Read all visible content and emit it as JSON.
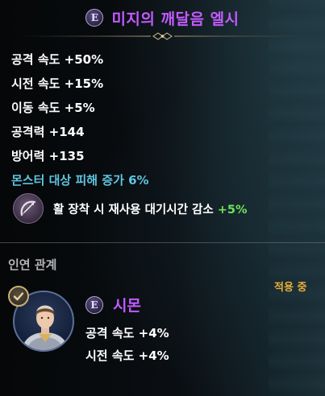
{
  "item": {
    "grade_letter": "E",
    "name": "미지의 깨달음 엘시"
  },
  "stats": [
    "공격 속도 +50%",
    "시전 속도 +15%",
    "이동 속도 +5%",
    "공격력 +144",
    "방어력 +135",
    "몬스터 대상 피해 증가 6%"
  ],
  "effect": {
    "icon": "bow-icon",
    "text": "활 장착 시 재사용 대기시간 감소",
    "bonus": "+5%"
  },
  "relation": {
    "section_title": "인연 관계",
    "applied_label": "적용 중",
    "companion": {
      "grade_letter": "E",
      "name": "시몬",
      "portrait": "companion-portrait",
      "stats": [
        "공격 속도 +4%",
        "시전 속도 +4%"
      ]
    }
  },
  "colors": {
    "grade_purple": "#c25bff",
    "stat_cyan": "#5fc4e0",
    "bonus_green": "#6fe35a",
    "applied_orange": "#f0b034"
  }
}
